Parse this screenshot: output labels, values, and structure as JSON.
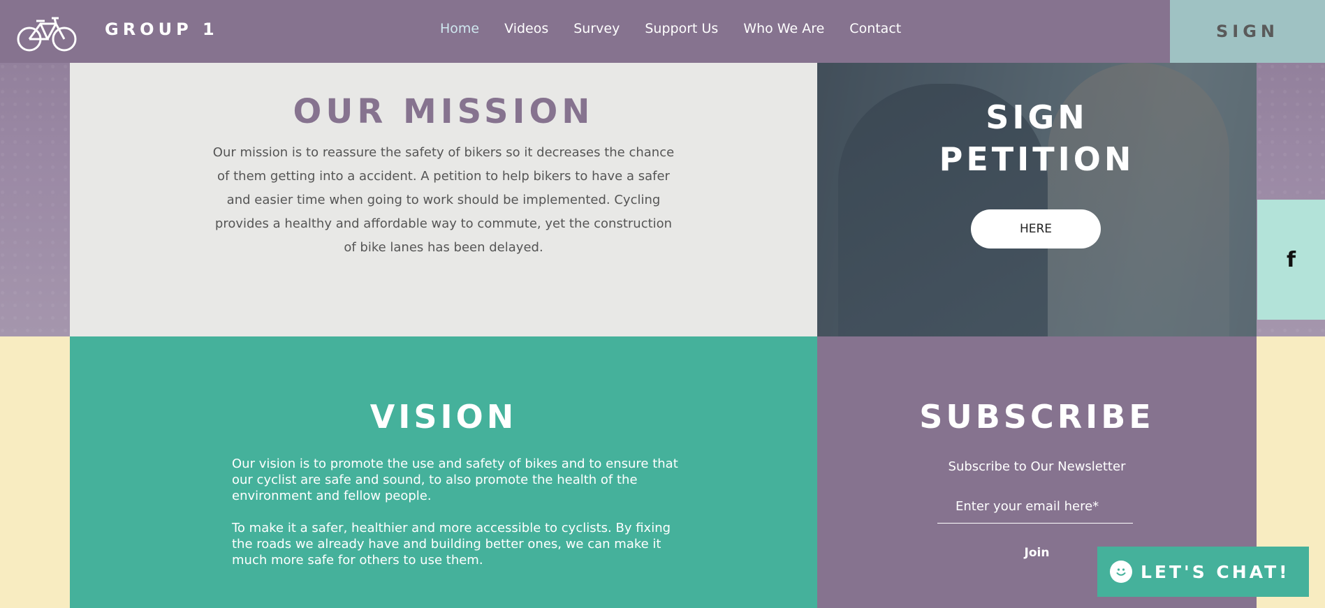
{
  "header": {
    "brand": "GROUP 1",
    "nav": [
      {
        "label": "Home",
        "active": true
      },
      {
        "label": "Videos"
      },
      {
        "label": "Survey"
      },
      {
        "label": "Support Us"
      },
      {
        "label": "Who We Are"
      },
      {
        "label": "Contact"
      }
    ],
    "sign_label": "SIGN",
    "logo_icon": "bicycle-icon"
  },
  "mission": {
    "title": "OUR MISSION",
    "body": "Our mission is to reassure the safety of bikers so it decreases the chance of them getting into a accident. A petition to help bikers to have a safer and easier time when going to work should be implemented. Cycling provides a healthy and affordable way to commute, yet the construction of bike lanes has been delayed."
  },
  "petition": {
    "title_line1": "SIGN",
    "title_line2": "PETITION",
    "button_label": "HERE"
  },
  "social": {
    "facebook_icon": "facebook-icon",
    "facebook_glyph": "f"
  },
  "vision": {
    "title": "VISION",
    "paragraph1": "Our vision is to promote the use and safety of bikes and to ensure that our cyclist are safe and sound, to also promote the health of the environment and fellow people.",
    "paragraph2": "To make it a safer, healthier and more accessible to cyclists. By fixing the roads we already have and building better ones, we can make it much more safe for others to use them."
  },
  "subscribe": {
    "title": "SUBSCRIBE",
    "label": "Subscribe to Our Newsletter",
    "email_placeholder": "Enter your email here*",
    "join_label": "Join"
  },
  "chat": {
    "label": "LET'S CHAT!",
    "icon": "smiley-icon"
  },
  "colors": {
    "purple": "#86738f",
    "teal": "#45b19b",
    "light_teal": "#b3e3d9",
    "cream": "#f8ecc1",
    "grey": "#e8e8e6",
    "sign_bg": "#9fc2c3"
  }
}
